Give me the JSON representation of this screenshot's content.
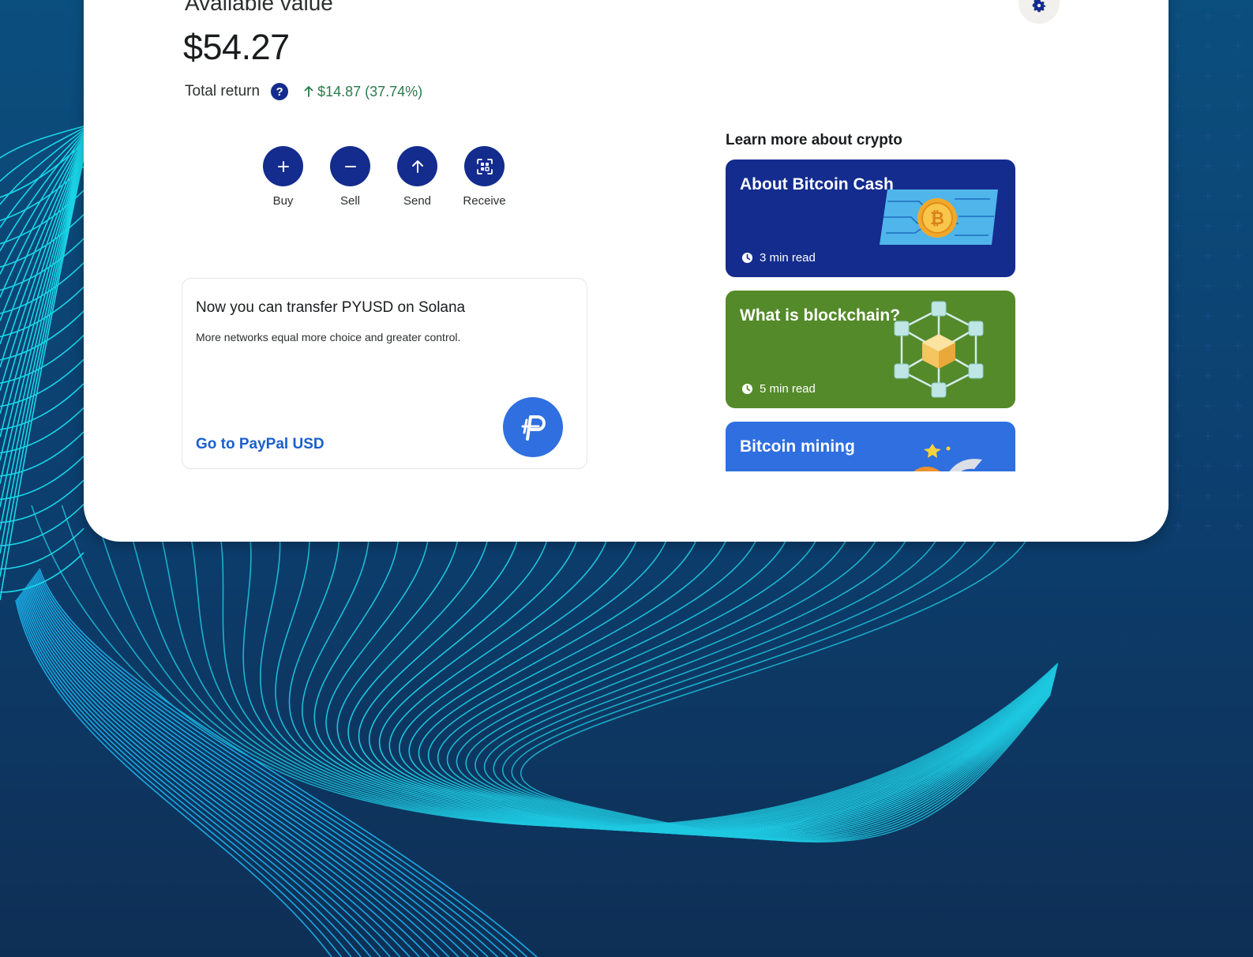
{
  "wallet": {
    "available_label": "Available value",
    "balance": "$54.27",
    "total_return_label": "Total return",
    "total_return_value": "$14.87 (37.74%)",
    "help_glyph": "?",
    "return_direction_icon": "arrow-up-icon"
  },
  "actions": [
    {
      "label": "Buy",
      "icon": "plus-icon"
    },
    {
      "label": "Sell",
      "icon": "minus-icon"
    },
    {
      "label": "Send",
      "icon": "arrow-up-icon"
    },
    {
      "label": "Receive",
      "icon": "qr-code-icon"
    }
  ],
  "promo": {
    "title": "Now you can transfer PYUSD on Solana",
    "description": "More networks equal more choice and greater control.",
    "link_label": "Go to PayPal USD",
    "logo_icon": "paypal-usd-logo"
  },
  "learn": {
    "heading": "Learn more about crypto",
    "articles": [
      {
        "title": "About Bitcoin Cash",
        "read_time": "3 min read",
        "color": "#142c8e",
        "art": "bitcoin-circuit-illustration"
      },
      {
        "title": "What is blockchain?",
        "read_time": "5 min read",
        "color": "#548a2a",
        "art": "blockchain-network-illustration"
      },
      {
        "title": "Bitcoin mining",
        "read_time": "",
        "color": "#2f6fe0",
        "art": "bitcoin-mining-illustration"
      }
    ]
  },
  "theme": {
    "brand_navy": "#142c8e",
    "link_blue": "#1a5fce",
    "positive_green": "#2a7a4a",
    "bg_line_cyan": "#1ec8e0"
  },
  "settings_icon": "gear-icon"
}
